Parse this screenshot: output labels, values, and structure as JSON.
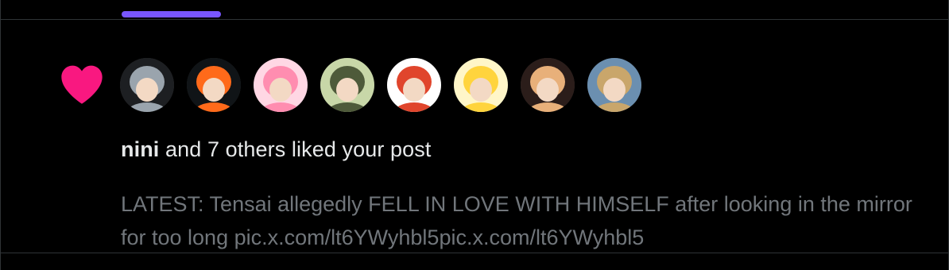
{
  "notification": {
    "type_icon": "heart-icon",
    "accent_color": "#f91880",
    "tab_indicator_color": "#7856ff",
    "avatars": [
      {
        "label": "anime character avatar 1",
        "colors": [
          "#9aa4ad",
          "#1d1f22"
        ]
      },
      {
        "label": "anime character avatar 2",
        "colors": [
          "#ff6a1a",
          "#101417"
        ]
      },
      {
        "label": "anime character avatar 3",
        "colors": [
          "#ff8db0",
          "#ffd7e4"
        ]
      },
      {
        "label": "anime character avatar 4",
        "colors": [
          "#4e5a3a",
          "#c8d7a8"
        ]
      },
      {
        "label": "anime character avatar 5",
        "colors": [
          "#e0452c",
          "#ffffff"
        ]
      },
      {
        "label": "anime character avatar 6",
        "colors": [
          "#ffd43d",
          "#fff6c8"
        ]
      },
      {
        "label": "anime character avatar 7",
        "colors": [
          "#e8b07a",
          "#2b1d1a"
        ]
      },
      {
        "label": "anime character avatar 8",
        "colors": [
          "#c9a66b",
          "#6b8fb0"
        ]
      }
    ],
    "actor_name": "nini",
    "action_text": " and 7 others liked your post",
    "post_preview": "LATEST: Tensai allegedly FELL IN LOVE WITH HIMSELF after looking in the mirror for too long pic.x.com/lt6YWyhbl5pic.x.com/lt6YWyhbl5"
  }
}
